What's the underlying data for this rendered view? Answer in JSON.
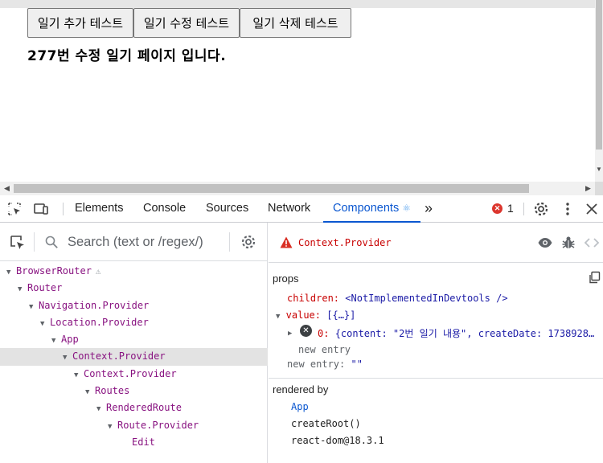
{
  "app_page": {
    "buttons": [
      "일기 추가 테스트",
      "일기 수정 테스트",
      "일기 삭제 테스트"
    ],
    "text": "277번 수정 일기 페이지 입니다."
  },
  "devtools": {
    "tabs": [
      "Elements",
      "Console",
      "Sources",
      "Network",
      "Components"
    ],
    "active_tab": "Components",
    "more_tabs_glyph": "»",
    "error_count": "1",
    "error_glyph": "✕",
    "search_placeholder": "Search (text or /regex/)",
    "tree": [
      {
        "label": "BrowserRouter",
        "depth": 0,
        "warn": true
      },
      {
        "label": "Router",
        "depth": 1
      },
      {
        "label": "Navigation.Provider",
        "depth": 2
      },
      {
        "label": "Location.Provider",
        "depth": 3
      },
      {
        "label": "App",
        "depth": 4
      },
      {
        "label": "Context.Provider",
        "depth": 5,
        "selected": true
      },
      {
        "label": "Context.Provider",
        "depth": 6
      },
      {
        "label": "Routes",
        "depth": 7
      },
      {
        "label": "RenderedRoute",
        "depth": 8
      },
      {
        "label": "Route.Provider",
        "depth": 9
      },
      {
        "label": "Edit",
        "depth": 10,
        "leaf": true
      }
    ],
    "selected_component": "Context.Provider",
    "props_label": "props",
    "props": {
      "children_key": "children:",
      "children_val": "<NotImplementedInDevtools />",
      "value_key": "value:",
      "value_val": "[{…}]",
      "item_key": "0:",
      "item_val": "{content: \"2번 일기 내용\", createDate: 1738928…",
      "new_entry_inner": "new entry",
      "new_entry_key": "new entry:",
      "new_entry_val": "\"\""
    },
    "rendered_by_label": "rendered by",
    "rendered_by": [
      "App",
      "createRoot()",
      "react-dom@18.3.1"
    ]
  }
}
